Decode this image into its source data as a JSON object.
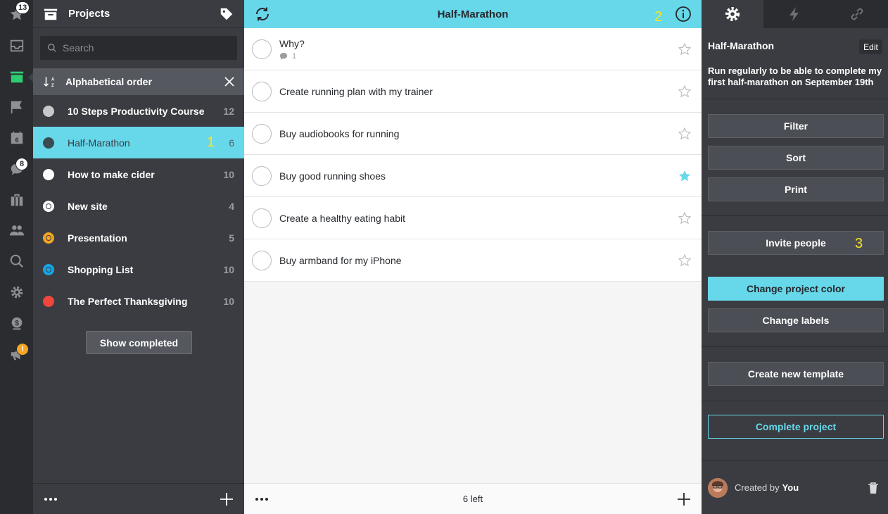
{
  "rail": {
    "badges": {
      "starred": "13",
      "conversations": "8",
      "feedback": "!"
    },
    "calendar_day": "6"
  },
  "projects_panel": {
    "title": "Projects",
    "search_placeholder": "Search",
    "sort_label": "Alphabetical order",
    "items": [
      {
        "name": "10 Steps Productivity Course",
        "count": "12",
        "color": "#c7c8ca",
        "style": "solid"
      },
      {
        "name": "Half-Marathon",
        "count": "6",
        "color": "#3a4c52",
        "style": "solid",
        "annotation": "1"
      },
      {
        "name": "How to make cider",
        "count": "10",
        "color": "#ffffff",
        "style": "solid"
      },
      {
        "name": "New site",
        "count": "4",
        "color": "#ffffff",
        "style": "ring"
      },
      {
        "name": "Presentation",
        "count": "5",
        "color": "#f5a623",
        "style": "ring"
      },
      {
        "name": "Shopping List",
        "count": "10",
        "color": "#13a9e8",
        "style": "ring"
      },
      {
        "name": "The Perfect Thanksgiving",
        "count": "10",
        "color": "#f0463c",
        "style": "solid"
      }
    ],
    "show_completed_label": "Show completed"
  },
  "task_panel": {
    "title": "Half-Marathon",
    "header_annotation": "2",
    "tasks": [
      {
        "name": "Why?",
        "comments": "1",
        "starred": false
      },
      {
        "name": "Create running plan with my trainer",
        "starred": false
      },
      {
        "name": "Buy audiobooks for running",
        "starred": false
      },
      {
        "name": "Buy good running shoes",
        "starred": true
      },
      {
        "name": "Create a healthy eating habit",
        "starred": false
      },
      {
        "name": "Buy armband for my iPhone",
        "starred": false
      }
    ],
    "footer_count": "6 left"
  },
  "details_panel": {
    "project_name": "Half-Marathon",
    "edit_label": "Edit",
    "description": "Run regularly to be able to complete my first half-marathon on September 19th",
    "buttons": {
      "filter": "Filter",
      "sort": "Sort",
      "print": "Print",
      "invite": "Invite people",
      "invite_annotation": "3",
      "change_color": "Change project color",
      "change_labels": "Change labels",
      "new_template": "Create new template",
      "complete": "Complete project"
    },
    "created_by_prefix": "Created by",
    "created_by_user": "You"
  },
  "colors": {
    "accent": "#67d7ea",
    "sidebar": "#3a3c41",
    "rail": "#2b2c30",
    "active_rail_icon": "#2ecc71",
    "star_active": "#67d7ea"
  }
}
